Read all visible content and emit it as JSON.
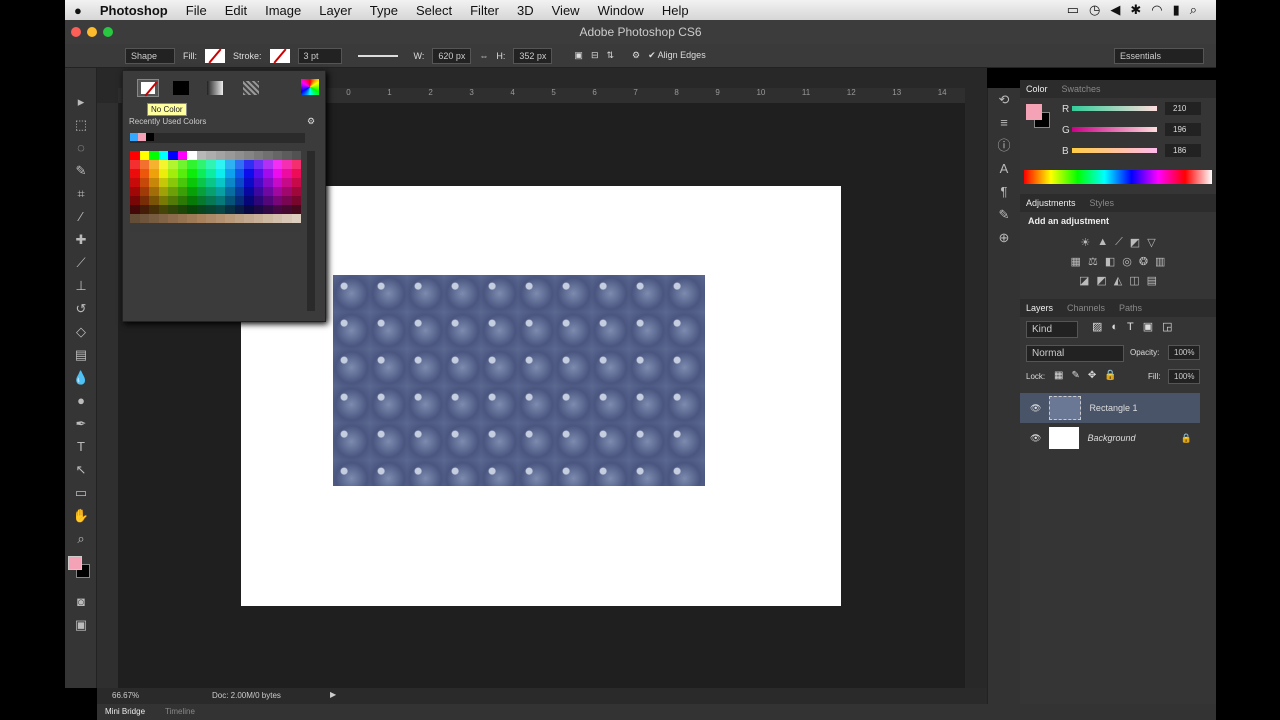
{
  "menubar": {
    "apple": "",
    "app": "Photoshop",
    "items": [
      "File",
      "Edit",
      "Image",
      "Layer",
      "Type",
      "Select",
      "Filter",
      "3D",
      "View",
      "Window",
      "Help"
    ]
  },
  "window": {
    "title": "Adobe Photoshop CS6"
  },
  "options": {
    "mode": "Shape",
    "fill_label": "Fill:",
    "stroke_label": "Stroke:",
    "stroke_width": "3 pt",
    "w_label": "W:",
    "width": "620 px",
    "h_label": "H:",
    "height": "352 px",
    "align_edges": "Align Edges",
    "workspace": "Essentials"
  },
  "popup": {
    "recent_label": "Recently Used Colors",
    "tooltip": "No Color"
  },
  "ruler": [
    "0",
    "1",
    "2",
    "3",
    "4",
    "5",
    "6",
    "7",
    "8",
    "9",
    "10",
    "11",
    "12",
    "13",
    "14"
  ],
  "status": {
    "zoom": "66.67%",
    "doc": "Doc: 2.00M/0 bytes"
  },
  "bottom_tabs": [
    "Mini Bridge",
    "Timeline"
  ],
  "color_panel": {
    "tabs": [
      "Color",
      "Swatches"
    ],
    "channels": [
      {
        "label": "R",
        "value": "210"
      },
      {
        "label": "G",
        "value": "196"
      },
      {
        "label": "B",
        "value": "186"
      }
    ],
    "foreground": "#f4a3b6",
    "background": "#000000"
  },
  "adjustments": {
    "tabs": [
      "Adjustments",
      "Styles"
    ],
    "heading": "Add an adjustment"
  },
  "layers_panel": {
    "tabs": [
      "Layers",
      "Channels",
      "Paths"
    ],
    "filter": "Kind",
    "blend": "Normal",
    "opacity_label": "Opacity:",
    "opacity": "100%",
    "lock_label": "Lock:",
    "fill_label": "Fill:",
    "fill": "100%",
    "layers": [
      {
        "name": "Rectangle 1",
        "selected": true
      },
      {
        "name": "Background",
        "selected": false
      }
    ]
  }
}
